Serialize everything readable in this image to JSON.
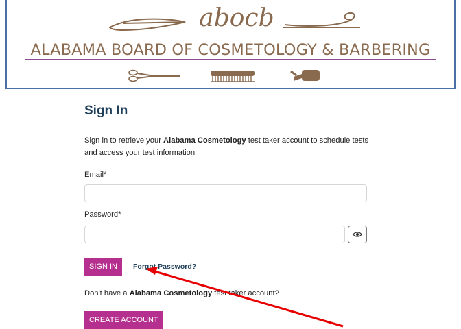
{
  "header": {
    "logo_text": "abocb",
    "board_name": "ALABAMA BOARD OF COSMETOLOGY & BARBERING",
    "icons": [
      "scissors-icon",
      "comb-icon",
      "hairdryer-icon"
    ],
    "colors": {
      "brown": "#8a6a4e",
      "purple_rule": "#8b4c8f",
      "frame": "#4a6fa5"
    }
  },
  "signin": {
    "title": "Sign In",
    "intro_prefix": "Sign in to retrieve your ",
    "intro_bold": "Alabama Cosmetology",
    "intro_suffix": " test taker account to schedule tests and access your test information.",
    "email_label": "Email",
    "password_label": "Password",
    "required_mark": "*",
    "email_value": "",
    "password_value": "",
    "signin_button": "SIGN IN",
    "forgot_link": "Forgot Password?",
    "no_account_prefix": "Don't have a ",
    "no_account_bold": "Alabama Cosmetology",
    "no_account_suffix": " test taker account?",
    "create_button": "CREATE ACCOUNT"
  },
  "annotation": {
    "arrow_color": "#e60000"
  },
  "colors": {
    "button": "#b5308e",
    "title": "#1f3f5b"
  }
}
